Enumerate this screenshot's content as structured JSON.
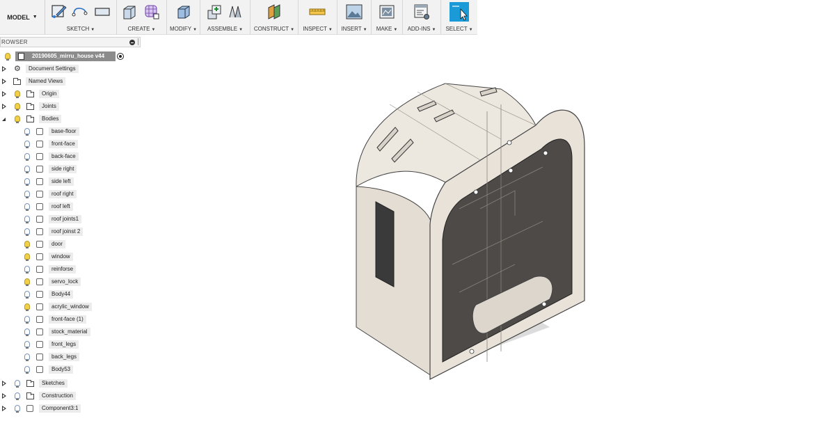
{
  "toolbar": {
    "mode": "MODEL",
    "groups": [
      {
        "label": "SKETCH"
      },
      {
        "label": "CREATE"
      },
      {
        "label": "MODIFY"
      },
      {
        "label": "ASSEMBLE"
      },
      {
        "label": "CONSTRUCT"
      },
      {
        "label": "INSPECT"
      },
      {
        "label": "INSERT"
      },
      {
        "label": "MAKE"
      },
      {
        "label": "ADD-INS"
      },
      {
        "label": "SELECT"
      }
    ],
    "accent": "#1a9ad6"
  },
  "browser": {
    "title": "ROWSER",
    "root": "20190605_mirru_house v44",
    "top_items": [
      {
        "label": "Document Settings",
        "icon": "gear-icon"
      },
      {
        "label": "Named Views",
        "icon": "folder-icon"
      },
      {
        "label": "Origin",
        "icon": "folder-icon"
      },
      {
        "label": "Joints",
        "icon": "folder-icon"
      },
      {
        "label": "Bodies",
        "icon": "folder-icon"
      }
    ],
    "bodies": [
      "base-floor",
      "front-face",
      "back-face",
      "side right",
      "side left",
      "roof right",
      "roof left",
      "roof joints1",
      "roof joinst 2",
      "door",
      "window",
      "reinforse",
      "servo_lock",
      "Body44",
      "acrylic_window",
      "front-face (1)",
      "stock_material",
      "front_legs",
      "back_legs",
      "Body53"
    ],
    "bottom_items": [
      {
        "label": "Sketches",
        "icon": "folder-icon"
      },
      {
        "label": "Construction",
        "icon": "folder-icon"
      },
      {
        "label": "Component3:1",
        "icon": "component-icon"
      }
    ]
  }
}
